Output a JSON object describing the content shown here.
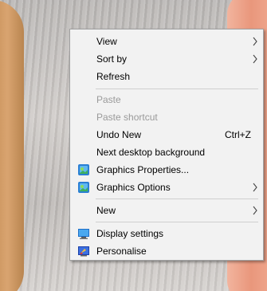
{
  "menu": {
    "items": [
      {
        "label": "View",
        "submenu": true
      },
      {
        "label": "Sort by",
        "submenu": true
      },
      {
        "label": "Refresh"
      },
      {
        "label": "Paste",
        "disabled": true
      },
      {
        "label": "Paste shortcut",
        "disabled": true
      },
      {
        "label": "Undo New",
        "shortcut": "Ctrl+Z"
      },
      {
        "label": "Next desktop background"
      },
      {
        "label": "Graphics Properties...",
        "icon": "graphics-icon"
      },
      {
        "label": "Graphics Options",
        "icon": "graphics-icon",
        "submenu": true
      },
      {
        "label": "New",
        "submenu": true
      },
      {
        "label": "Display settings",
        "icon": "display-icon"
      },
      {
        "label": "Personalise",
        "icon": "personalise-icon"
      }
    ]
  }
}
